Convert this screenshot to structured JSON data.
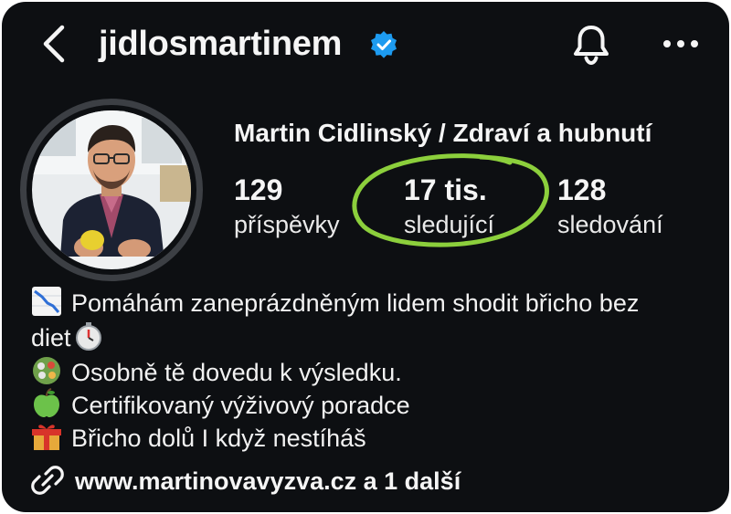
{
  "header": {
    "username": "jidlosmartinem"
  },
  "profile": {
    "full_name": "Martin Cidlinský / Zdraví a hubnutí",
    "stats": [
      {
        "value": "129",
        "label": "příspěvky"
      },
      {
        "value": "17 tis.",
        "label": "sledující"
      },
      {
        "value": "128",
        "label": "sledování"
      }
    ],
    "highlight_color": "#8ccf3c",
    "verified_color": "#1d9bf0"
  },
  "bio": {
    "line1": "Pomáhám zaneprázdněným lidem shodit břicho bez",
    "line2": "diet",
    "line3": "Osobně tě dovedu k výsledku.",
    "line4": "Certifikovaný výživový poradce",
    "line5": "Břicho dolů I když nestíháš",
    "icons": [
      "chart-decreasing-icon",
      "stopwatch-icon",
      "salad-icon",
      "green-apple-icon",
      "gift-icon"
    ]
  },
  "link": {
    "text": "www.martinovavyzva.cz a 1 další"
  }
}
